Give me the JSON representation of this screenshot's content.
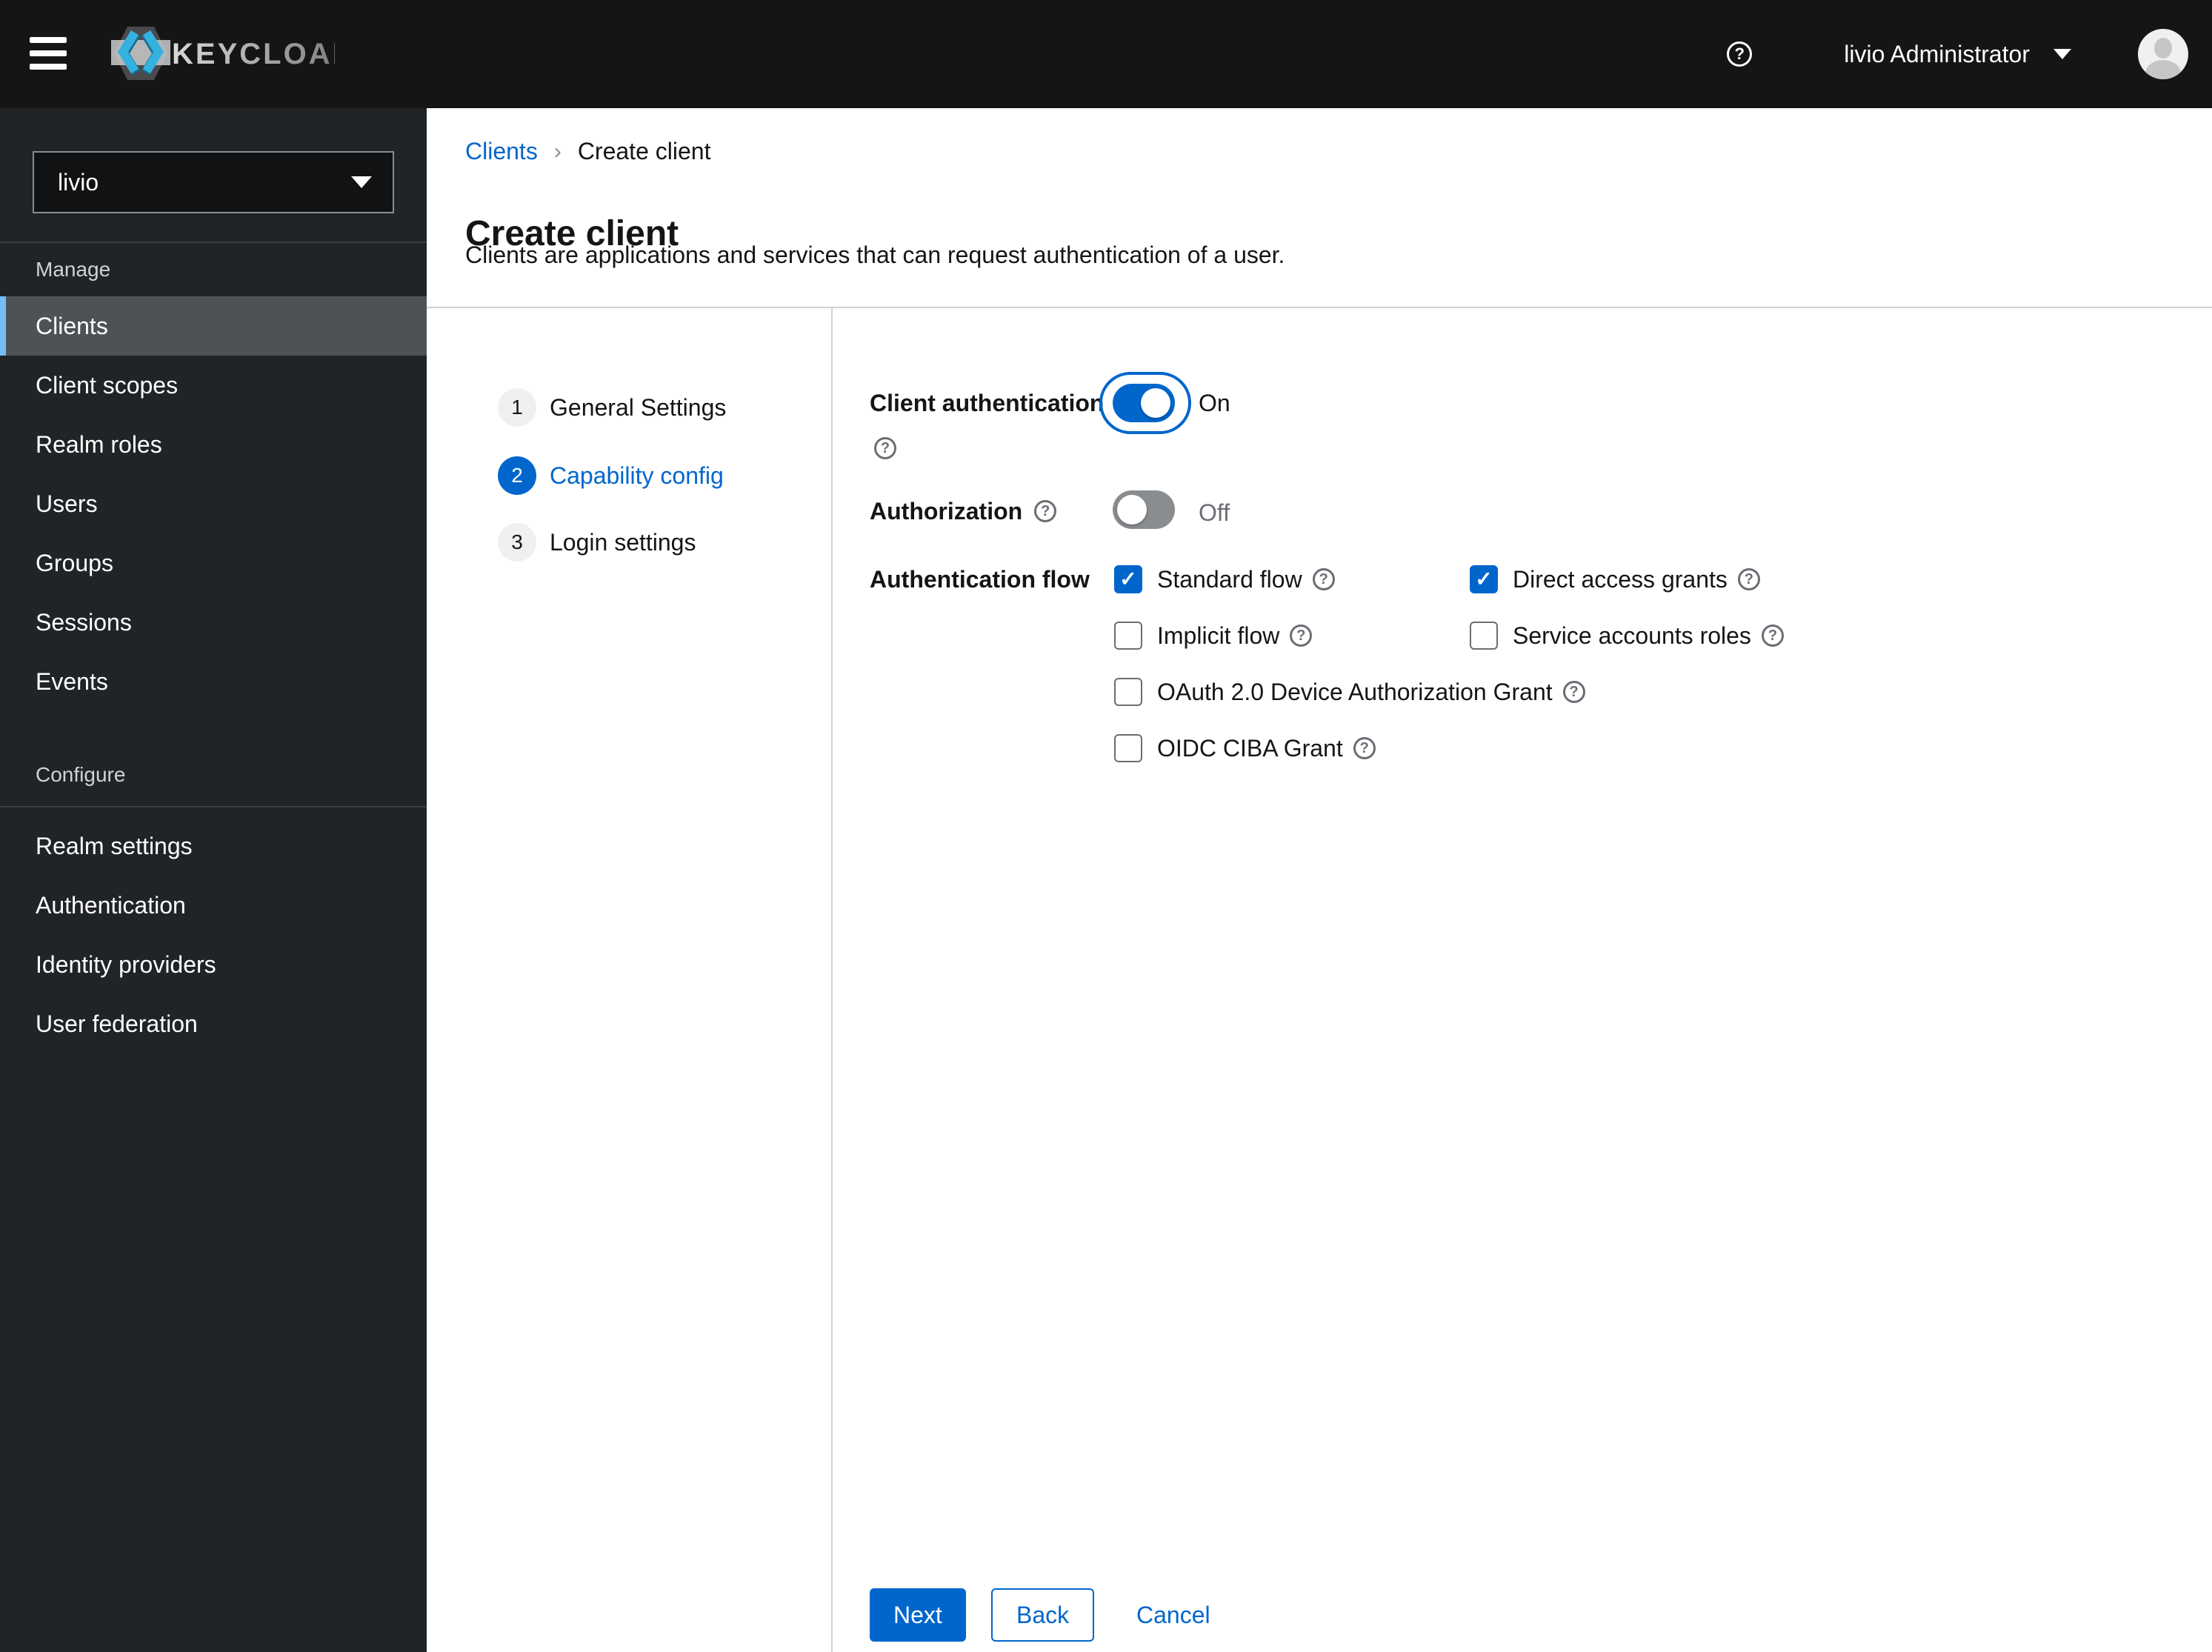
{
  "header": {
    "brand": "KEYCLOAK",
    "user_menu": {
      "label": "livio Administrator"
    }
  },
  "sidebar": {
    "realm_selector": {
      "value": "livio"
    },
    "sections": [
      {
        "title": "Manage",
        "items": [
          {
            "label": "Clients",
            "current": true
          },
          {
            "label": "Client scopes",
            "current": false
          },
          {
            "label": "Realm roles",
            "current": false
          },
          {
            "label": "Users",
            "current": false
          },
          {
            "label": "Groups",
            "current": false
          },
          {
            "label": "Sessions",
            "current": false
          },
          {
            "label": "Events",
            "current": false
          }
        ]
      },
      {
        "title": "Configure",
        "items": [
          {
            "label": "Realm settings",
            "current": false
          },
          {
            "label": "Authentication",
            "current": false
          },
          {
            "label": "Identity providers",
            "current": false
          },
          {
            "label": "User federation",
            "current": false
          }
        ]
      }
    ]
  },
  "breadcrumb": {
    "items": [
      "Clients",
      "Create client"
    ]
  },
  "page": {
    "title": "Create client",
    "description": "Clients are applications and services that can request authentication of a user."
  },
  "wizard": {
    "steps": [
      {
        "number": "1",
        "label": "General Settings",
        "current": false
      },
      {
        "number": "2",
        "label": "Capability config",
        "current": true
      },
      {
        "number": "3",
        "label": "Login settings",
        "current": false
      }
    ]
  },
  "form": {
    "client_authentication": {
      "label": "Client authentication",
      "value": "On",
      "enabled": true
    },
    "authorization": {
      "label": "Authorization",
      "value": "Off",
      "enabled": false
    },
    "authentication_flow": {
      "label": "Authentication flow",
      "options": [
        {
          "label": "Standard flow",
          "checked": true
        },
        {
          "label": "Direct access grants",
          "checked": true
        },
        {
          "label": "Implicit flow",
          "checked": false
        },
        {
          "label": "Service accounts roles",
          "checked": false
        },
        {
          "label": "OAuth 2.0 Device Authorization Grant",
          "checked": false
        },
        {
          "label": "OIDC CIBA Grant",
          "checked": false
        }
      ]
    }
  },
  "footer": {
    "next": "Next",
    "back": "Back",
    "cancel": "Cancel"
  },
  "colors": {
    "primary": "#0066cc",
    "header_bg": "#151515",
    "sidebar_bg": "#212427",
    "nav_selected_bg": "#4f5255",
    "nav_selected_accent": "#73bcf7",
    "divider": "#d2d2d2",
    "muted_text": "#6a6e73",
    "switch_off": "#8a8d90"
  }
}
